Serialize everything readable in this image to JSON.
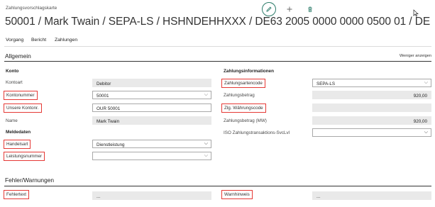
{
  "header": {
    "caption": "Zahlungsvorschlagskarte",
    "title": "50001 / Mark Twain / SEPA-LS / HSHNDEHHXXX / DE63 2005 0000 0000 0500 01 / DE",
    "icons": [
      "pencil-icon",
      "plus-icon",
      "trash-icon"
    ]
  },
  "menu": {
    "items": [
      "Vorgang",
      "Bericht",
      "Zahlungen"
    ]
  },
  "general": {
    "title": "Allgemein",
    "show_less": "Weniger anzeigen",
    "konto": {
      "group": "Konto",
      "kontoart_label": "Kontoart",
      "kontoart_value": "Debitor",
      "kontonummer_label": "Kontonummer",
      "kontonummer_value": "50001",
      "unsere_kontonr_label": "Unsere Kontonr.",
      "unsere_kontonr_value": "OUR 50001",
      "name_label": "Name",
      "name_value": "Mark Twain"
    },
    "meldedaten": {
      "group": "Meldedaten",
      "handelsart_label": "Handelsart",
      "handelsart_value": "Dienstleistung",
      "leistungsnummer_label": "Leistungsnummer",
      "leistungsnummer_value": ""
    },
    "zahlung": {
      "group": "Zahlungsinformationen",
      "zahlungsartencode_label": "Zahlungsartencode",
      "zahlungsartencode_value": "SEPA-LS",
      "zahlungsbetrag_label": "Zahlungsbetrag",
      "zahlungsbetrag_value": "920,00",
      "waehrungscode_label": "Zlg. Währungscode",
      "waehrungscode_value": "",
      "zahlungsbetrag_mw_label": "Zahlungsbetrag (MW)",
      "zahlungsbetrag_mw_value": "920,00",
      "iso_label": "ISO Zahlungstransaktions-SvcLvl",
      "iso_value": ""
    }
  },
  "errors": {
    "title": "Fehler/Warnungen",
    "fehlertext_label": "Fehlertext",
    "fehlertext_value": "...",
    "warnhinweis_label": "Warnhinweis",
    "warnhinweis_value": "..."
  },
  "colors": {
    "highlight": "#e53935",
    "edit_accent": "#2e7d6b",
    "readonly_bg": "#e9e9e9"
  }
}
